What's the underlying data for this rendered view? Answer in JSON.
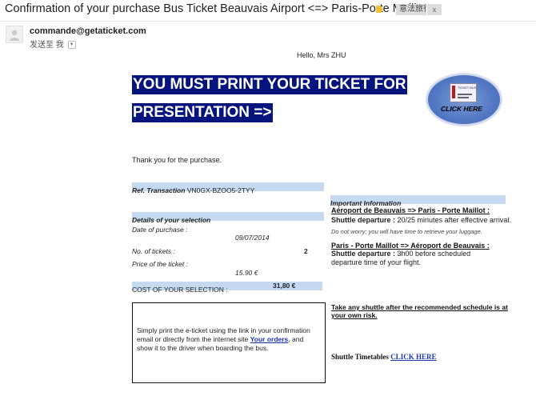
{
  "email": {
    "subject": "Confirmation of your purchase Bus Ticket Beauvais Airport <=> Paris-Porte Maillot",
    "label_chip": "意法旅行",
    "label_close": "x",
    "sender": "commande@getaticket.com",
    "to_line": "发送至 我"
  },
  "content": {
    "greeting": "Hello, Mrs ZHU",
    "banner_line1": "YOU MUST PRINT YOUR TICKET FOR",
    "banner_line2": "PRESENTATION =>",
    "click_here_badge": "CLICK HERE",
    "ticket_image_text": "TICKET BUS",
    "thanks": "Thank you for the purchase.",
    "ref_label": "Ref. Transaction",
    "ref_value": "VN0GX-BZOO5-2TYY",
    "details_header": "Details of your selection",
    "date_label": "Date of purchase :",
    "date_value": "09/07/2014",
    "tickets_label": "No. of tickets :",
    "tickets_value": "2",
    "price_label": "Price of the ticket :",
    "price_value": "15.90 €",
    "cost_label": "COST OF YOUR SELECTION :",
    "cost_value": "31,80 €",
    "important_header": "Important Information",
    "route1_title": "Aéroport de Beauvais => Paris - Porte Maillot :",
    "route1_label": "Shuttle departure :",
    "route1_text": "20/25 minutes after effective arrival.",
    "route1_note": "Do not worry; you will have time to retrieve your luggage.",
    "route2_title": "Paris - Porte Maillot => Aéroport de Beauvais :",
    "route2_label": "Shuttle departure :",
    "route2_text": "3h00 before scheduled",
    "route2_text2": "departure time of your flight.",
    "print_text_before": "Simply print the e-ticket using the link in your confirmation email or directly from the internet site ",
    "print_link": "Your orders",
    "print_text_after": ", and show it to the driver when boarding the bus.",
    "shuttle_note": "Take any shuttle after the recommended schedule is at your own risk.",
    "timetables_label": "Shuttle Timetables",
    "timetables_link": "CLICK HERE"
  },
  "colors": {
    "banner_bg": "#05157d",
    "section_bar": "#c5d9f1",
    "link": "#1a36b4",
    "label_icon": "#f0c036"
  },
  "icons": {
    "label": "label-tag-icon",
    "avatar": "person-avatar-icon",
    "dropdown": "chevron-down-icon"
  }
}
